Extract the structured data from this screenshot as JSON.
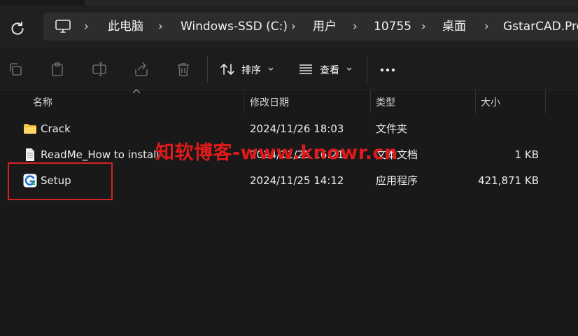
{
  "breadcrumb": [
    "此电脑",
    "Windows-SSD (C:)",
    "用户",
    "10755",
    "桌面",
    "GstarCAD.Pro"
  ],
  "toolbar": {
    "sort_label": "排序",
    "view_label": "查看"
  },
  "columns": {
    "name": "名称",
    "modified": "修改日期",
    "type": "类型",
    "size": "大小"
  },
  "files": [
    {
      "name": "Crack",
      "modified": "2024/11/26 18:03",
      "type": "文件夹",
      "size": "",
      "icon": "folder-icon"
    },
    {
      "name": "ReadMe_How to install",
      "modified": "2024/11/25 16:21",
      "type": "文本文档",
      "size": "1 KB",
      "icon": "text-file-icon"
    },
    {
      "name": "Setup",
      "modified": "2024/11/25 14:12",
      "type": "应用程序",
      "size": "421,871 KB",
      "icon": "gstarcad-app-icon"
    }
  ],
  "watermark": "知软博客-www.knowr.cn",
  "colors": {
    "background": "#191919",
    "toolbar": "#1c1c1c",
    "address_bar": "#2d2d2d",
    "highlight_box": "#d42222",
    "folder": "#f4c542"
  }
}
